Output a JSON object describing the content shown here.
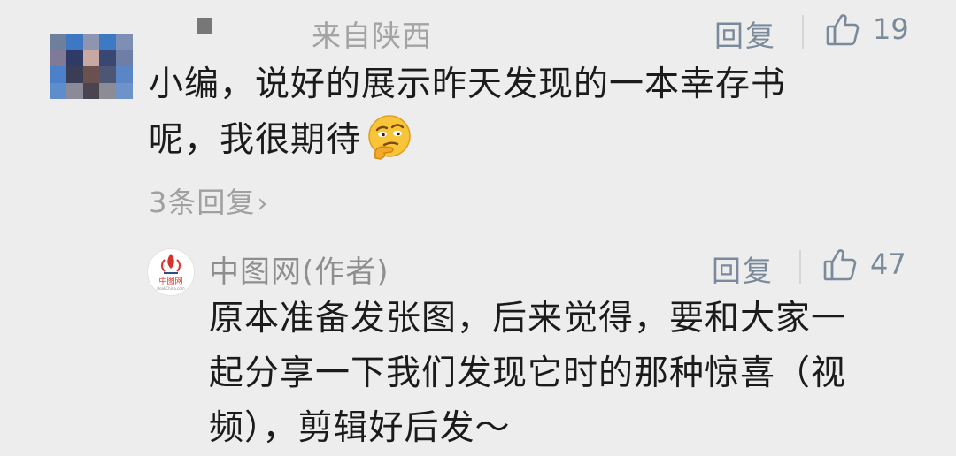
{
  "comment": {
    "location": "来自陕西",
    "reply_label": "回复",
    "like_count": "19",
    "text_line1": "小编，说好的展示昨天发现的一本幸存书",
    "text_line2": "呢，我很期待",
    "emoji": "thinking-face-emoji",
    "replies_link": "3条回复",
    "replies_chevron": "›"
  },
  "author_reply": {
    "author_name": "中图网(作者)",
    "reply_label": "回复",
    "like_count": "47",
    "avatar_text": "中图网",
    "avatar_subtext": "BookChina.com",
    "text_line1": "原本准备发张图，后来觉得，要和大家一",
    "text_line2": "起分享一下我们发现它时的那种惊喜（视",
    "text_line3": "频），剪辑好后发～"
  },
  "colors": {
    "background": "#ededed",
    "meta_text": "#a3a3a3",
    "action_text": "#7a8a9a",
    "body_text": "#1b1b1b",
    "brand_red": "#d8322b"
  }
}
